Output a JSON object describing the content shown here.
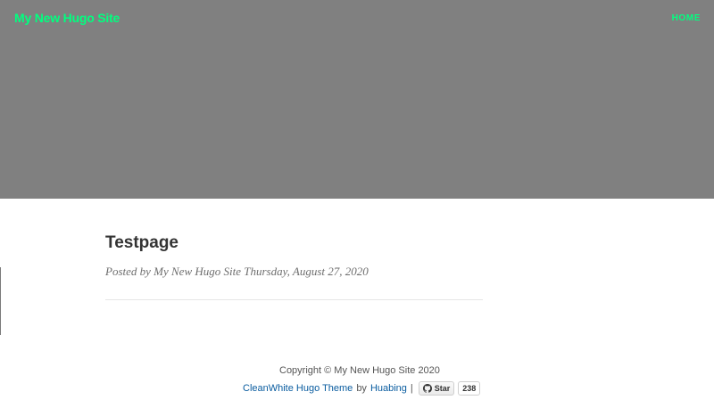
{
  "site": {
    "title": "My New Hugo Site",
    "nav": {
      "home_label": "HOME"
    },
    "colors": {
      "header_bg": "#808080",
      "brand": "#00ff7f",
      "link": "#0b5da0"
    }
  },
  "post": {
    "title": "Testpage",
    "meta": "Posted by My New Hugo Site Thursday, August 27, 2020"
  },
  "footer": {
    "copyright": "Copyright © My New Hugo Site 2020",
    "theme_link": "CleanWhite Hugo Theme",
    "by_text": "by",
    "author_link": "Huabing",
    "separator": "|",
    "star_label": "Star",
    "star_count": "238",
    "star_icon": "github-icon"
  }
}
